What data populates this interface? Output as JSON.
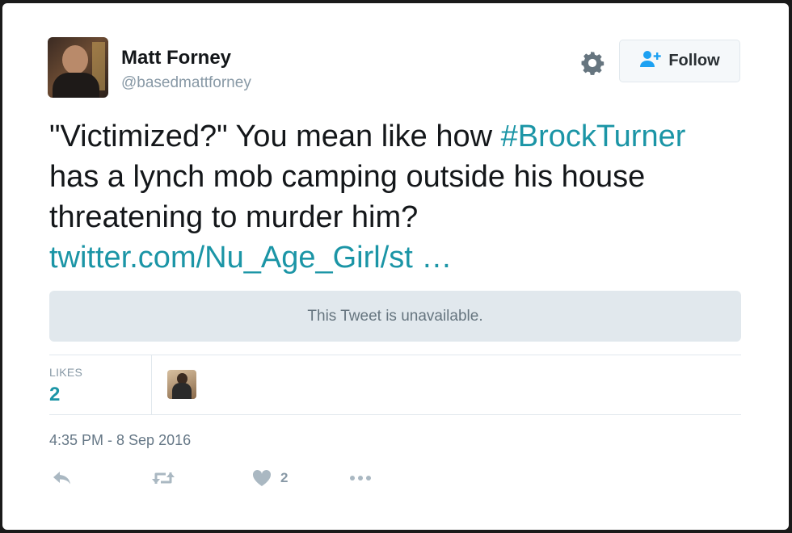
{
  "tweet": {
    "author_name": "Matt Forney",
    "author_handle": "@basedmattforney",
    "follow_label": "Follow",
    "text_lines": [
      "\"Victimized?\" You mean like how ",
      "has a lynch mob camping outside his house",
      "threatening to murder him?"
    ],
    "hashtag": "#BrockTurner",
    "link_text": "twitter.com/Nu_Age_Girl/st …",
    "quoted_unavailable": "This Tweet is unavailable.",
    "likes_label": "LIKES",
    "likes_count": "2",
    "timestamp": "4:35 PM - 8 Sep 2016",
    "heart_count": "2"
  },
  "colors": {
    "accent": "#1b95a6",
    "text": "#14171a",
    "muted": "#8899a6",
    "border": "#e1e8ed"
  },
  "icons": [
    "gear-icon",
    "follow-user-icon",
    "reply-icon",
    "retweet-icon",
    "heart-icon",
    "more-icon"
  ]
}
